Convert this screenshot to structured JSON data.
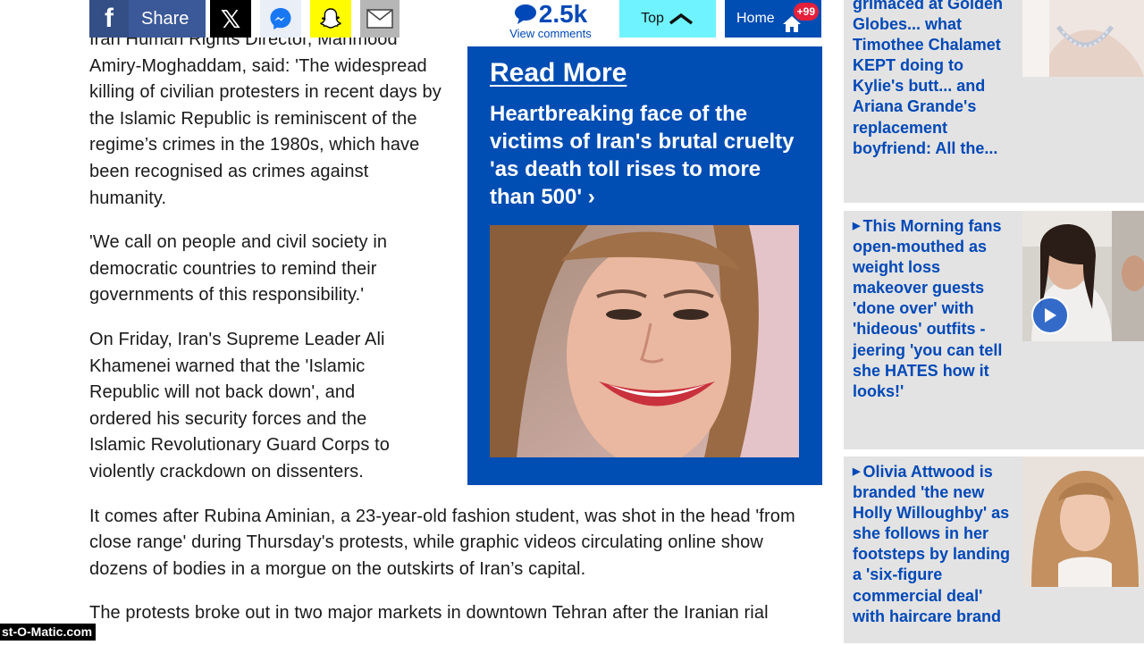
{
  "share_bar": {
    "facebook_label": "Share",
    "comments_count": "2.5k",
    "comments_label": "View comments",
    "top_label": "Top",
    "home_label": "Home",
    "home_badge": "+99"
  },
  "article": {
    "paragraphs": [
      "Iran Human Rights Director, Mahmood Amiry-Moghaddam, said: 'The widespread killing of civilian protesters in recent days by the Islamic Republic is reminiscent of the regime’s crimes in the 1980s, which have been recognised as crimes against humanity.",
      "'We call on people and civil society in democratic countries to remind their governments of this responsibility.'",
      "On Friday, Iran's Supreme Leader Ali Khamenei warned that the 'Islamic Republic will not back down', and ordered his security forces and the Islamic Revolutionary Guard Corps to violently crackdown on dissenters.",
      "It comes after Rubina Aminian, a 23-year-old fashion student, was shot in the head 'from close range' during Thursday's protests, while graphic videos circulating online show dozens of bodies in a morgue on the outskirts of Iran’s capital.",
      "The protests broke out in two major markets in downtown Tehran after the Iranian rial"
    ]
  },
  "read_more": {
    "heading": "Read More",
    "title": "Heartbreaking face of the victims of Iran's brutal cruelty 'as death toll rises to more than 500'",
    "arrow": "›"
  },
  "sidebar": {
    "items": [
      {
        "text": "grimaced at Golden Globes... what Timothee Chalamet KEPT doing to Kylie's butt... and Ariana Grande's replacement boyfriend: All the..."
      },
      {
        "text": "This Morning fans open-mouthed as weight loss makeover guests 'done over' with 'hideous' outfits - jeering 'you can tell she HATES how it looks!'"
      },
      {
        "text": "Olivia Attwood is branded 'the new Holly Willoughby' as she follows in her footsteps by landing a 'six-figure commercial deal' with haircare brand"
      }
    ]
  },
  "watermark": "st-O-Matic.com",
  "colors": {
    "brand_blue": "#004db3",
    "link_blue": "#0048b7",
    "facebook": "#3b5998",
    "snapchat": "#fffc00",
    "top_button": "#6ff3ff",
    "badge_red": "#e5203a",
    "sidebar_bg": "#e3e3e3"
  },
  "icons": [
    "facebook-icon",
    "x-icon",
    "messenger-icon",
    "snapchat-icon",
    "mail-icon",
    "comment-icon",
    "chevron-up-icon",
    "home-icon",
    "play-icon",
    "arrow-right-icon"
  ]
}
